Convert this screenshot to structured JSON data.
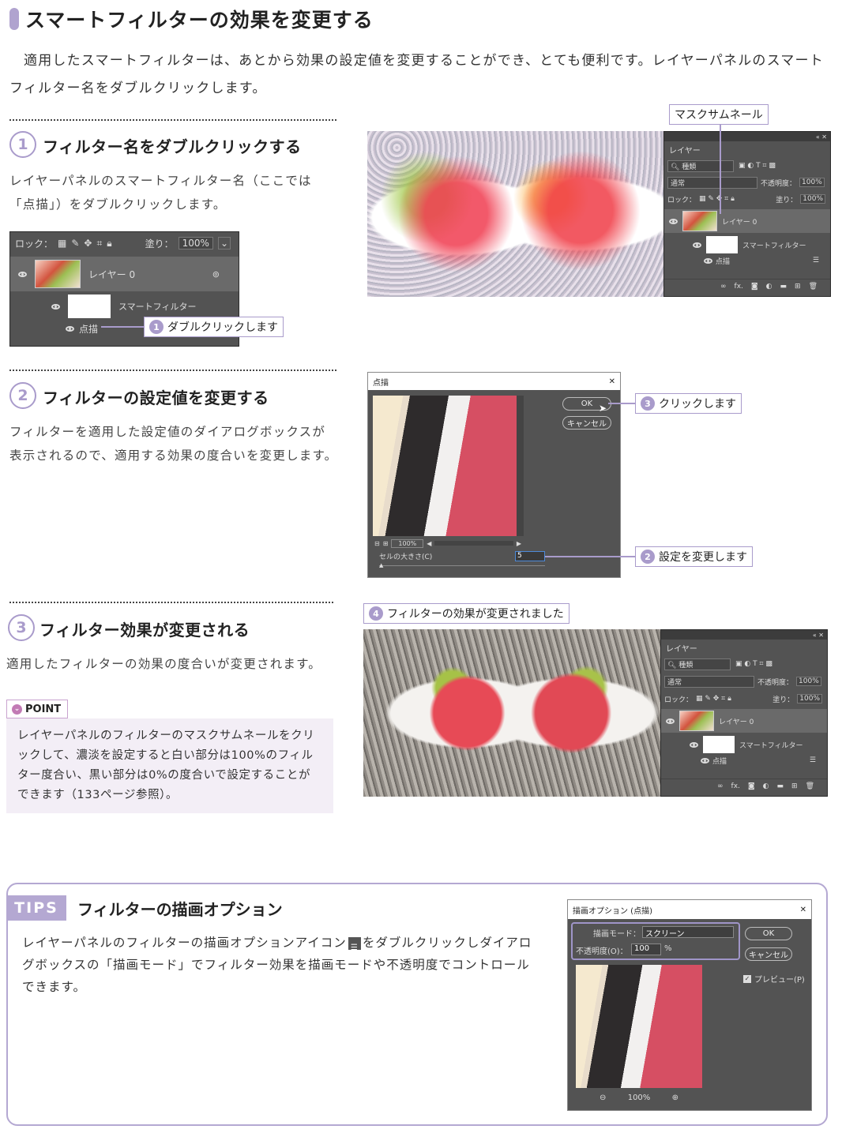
{
  "section": {
    "title": "スマートフィルターの効果を変更する",
    "intro": "適用したスマートフィルターは、あとから効果の設定値を変更することができ、とても便利です。レイヤーパネルのスマートフィルター名をダブルクリックします。"
  },
  "steps": [
    {
      "num": "1",
      "title": "フィルター名をダブルクリックする",
      "body": "レイヤーパネルのスマートフィルター名（ここでは「点描」）をダブルクリックします。"
    },
    {
      "num": "2",
      "title": "フィルターの設定値を変更する",
      "body": "フィルターを適用した設定値のダイアログボックスが表示されるので、適用する効果の度合いを変更します。"
    },
    {
      "num": "3",
      "title": "フィルター効果が変更される",
      "body": "適用したフィルターの効果の度合いが変更されます。"
    }
  ],
  "layer_panel": {
    "tab": "レイヤー",
    "search": "種類",
    "blend_mode": "通常",
    "opacity_label": "不透明度：",
    "opacity_value": "100%",
    "lock_label": "ロック：",
    "fill_label": "塗り：",
    "fill_value": "100%",
    "layer_name": "レイヤー 0",
    "smart_filter": "スマートフィルター",
    "filter_name": "点描",
    "fx": "fx."
  },
  "callouts": {
    "mask_thumbnail": "マスクサムネール",
    "c1_num": "1",
    "c1": "ダブルクリックします",
    "c2_num": "2",
    "c2": "設定を変更します",
    "c3_num": "3",
    "c3": "クリックします",
    "c4_num": "4",
    "c4": "フィルターの効果が変更されました"
  },
  "pointillize_dialog": {
    "title": "点描",
    "ok": "OK",
    "cancel": "キャンセル",
    "zoom": "100%",
    "cell_size_label": "セルの大きさ(C)",
    "cell_size_value": "5"
  },
  "point": {
    "badge": "POINT",
    "text": "レイヤーパネルのフィルターのマスクサムネールをクリックして、濃淡を設定すると白い部分は100%のフィルター度合い、黒い部分は0%の度合いで設定することができます（133ページ参照）。"
  },
  "tips": {
    "badge": "TIPS",
    "title": "フィルターの描画オプション",
    "text_before_icon": "レイヤーパネルのフィルターの描画オプションアイコン",
    "text_after_icon": "をダブルクリックしダイアログボックスの「描画モード」でフィルター効果を描画モードや不透明度でコントロールできます。"
  },
  "blend_dialog": {
    "title": "描画オプション (点描)",
    "mode_label": "描画モード：",
    "mode_value": "スクリーン",
    "opacity_label": "不透明度(O)：",
    "opacity_value": "100",
    "opacity_unit": "%",
    "ok": "OK",
    "cancel": "キャンセル",
    "preview": "プレビュー(P)",
    "zoom": "100%"
  }
}
